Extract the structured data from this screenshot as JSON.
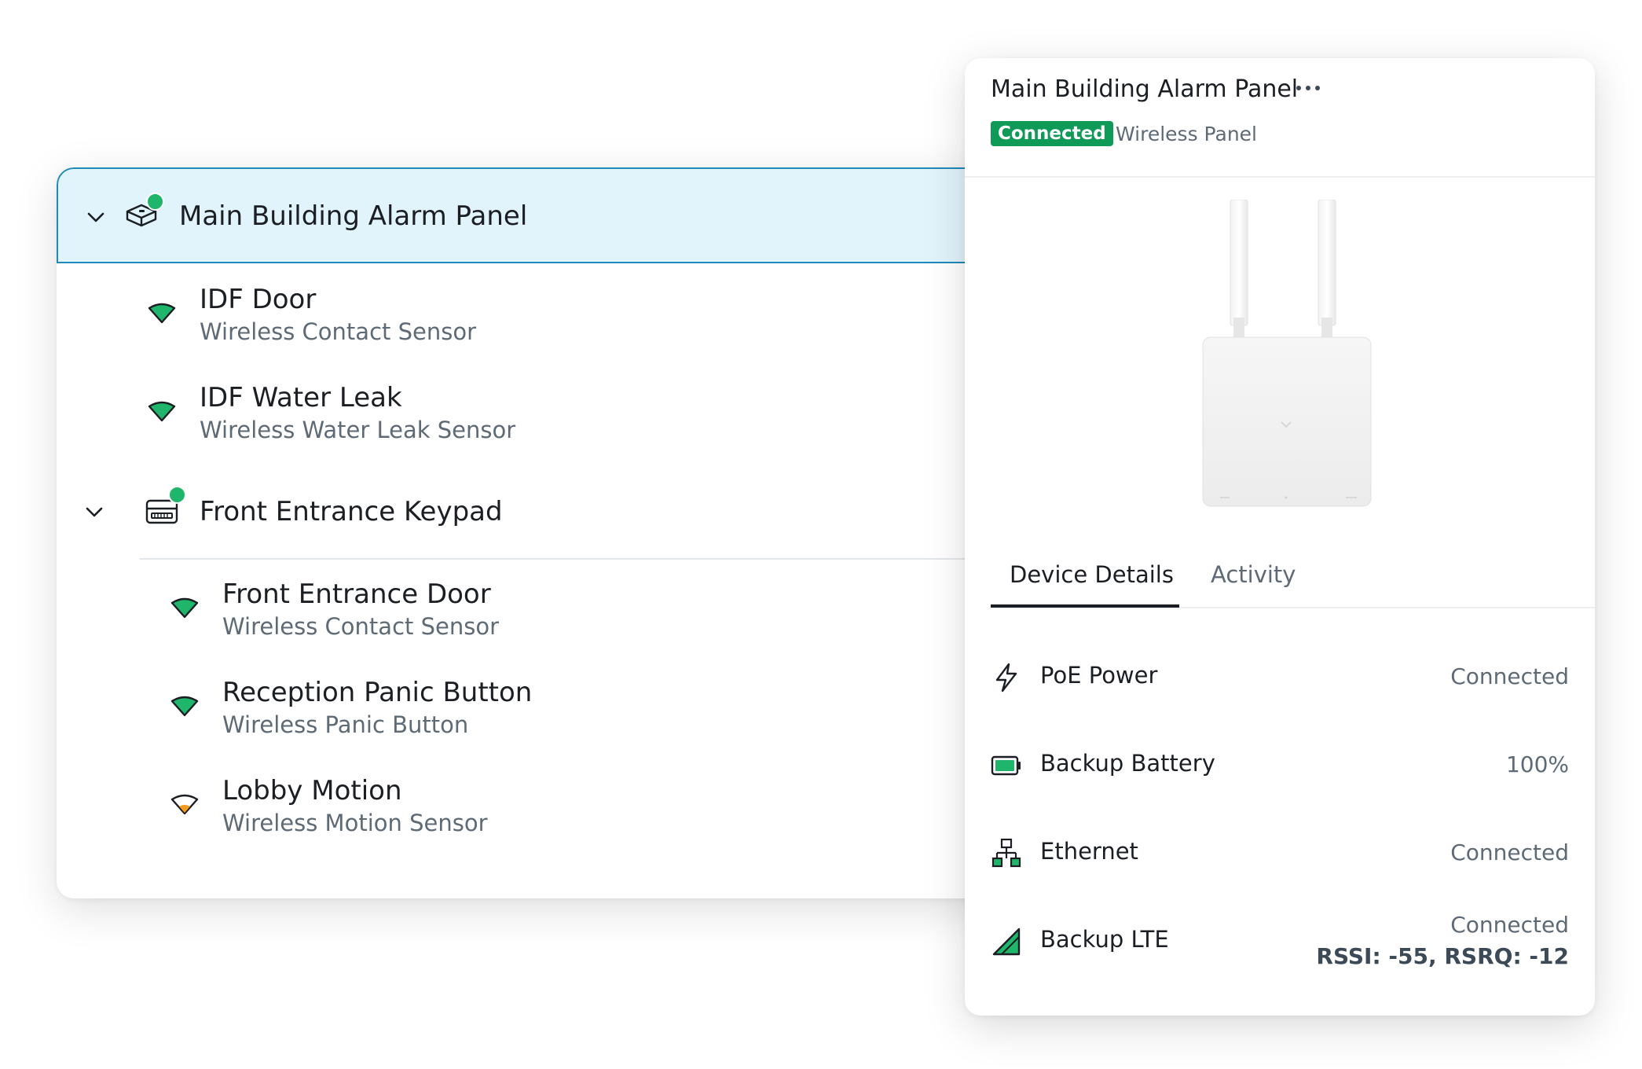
{
  "tree": {
    "panel": {
      "title": "Main Building Alarm Panel",
      "icon": "alarm-panel-icon",
      "status": "online"
    },
    "panel_children": [
      {
        "name": "IDF Door",
        "type": "Wireless Contact Sensor",
        "icon": "signal-strong-icon"
      },
      {
        "name": "IDF Water Leak",
        "type": "Wireless Water Leak Sensor",
        "icon": "signal-strong-icon"
      }
    ],
    "keypad": {
      "title": "Front Entrance Keypad",
      "icon": "keypad-icon",
      "status": "online"
    },
    "keypad_children": [
      {
        "name": "Front Entrance Door",
        "type": "Wireless Contact Sensor",
        "icon": "signal-strong-icon"
      },
      {
        "name": "Reception Panic Button",
        "type": "Wireless Panic Button",
        "icon": "signal-strong-icon"
      },
      {
        "name": "Lobby Motion",
        "type": "Wireless Motion Sensor",
        "icon": "signal-weak-icon"
      }
    ]
  },
  "detail": {
    "title": "Main Building Alarm Panel",
    "status_badge": "Connected",
    "device_type": "Wireless Panel",
    "tabs": [
      {
        "label": "Device Details",
        "active": true
      },
      {
        "label": "Activity",
        "active": false
      }
    ],
    "rows": [
      {
        "label": "PoE Power",
        "value": "Connected",
        "icon": "bolt-icon"
      },
      {
        "label": "Backup Battery",
        "value": "100%",
        "icon": "battery-icon"
      },
      {
        "label": "Ethernet",
        "value": "Connected",
        "icon": "network-icon"
      },
      {
        "label": "Backup LTE",
        "value": "Connected",
        "value_detail": "RSSI: -55, RSRQ: -12",
        "icon": "cellular-icon"
      }
    ]
  },
  "colors": {
    "accent_green": "#1fb56b",
    "badge_green": "#0f9a58",
    "selection_bg": "#e2f4fb",
    "selection_border": "#1f89b7",
    "signal_weak": "#f39c1f"
  }
}
